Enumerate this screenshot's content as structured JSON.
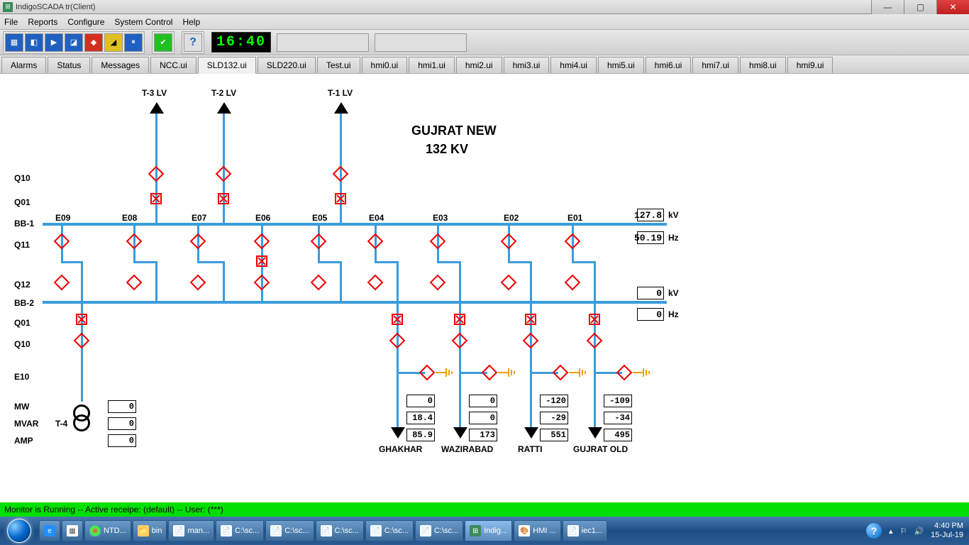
{
  "window": {
    "title": "IndigoSCADA tr(Client)"
  },
  "menu": {
    "items": [
      "File",
      "Reports",
      "Configure",
      "System Control",
      "Help"
    ]
  },
  "toolbar": {
    "clock": "16:40"
  },
  "tabs": {
    "items": [
      "Alarms",
      "Status",
      "Messages",
      "NCC.ui",
      "SLD132.ui",
      "SLD220.ui",
      "Test.ui",
      "hmi0.ui",
      "hmi1.ui",
      "hmi2.ui",
      "hmi3.ui",
      "hmi4.ui",
      "hmi5.ui",
      "hmi6.ui",
      "hmi7.ui",
      "hmi8.ui",
      "hmi9.ui"
    ],
    "active": 4
  },
  "diagram": {
    "title1": "GUJRAT NEW",
    "title2": "132 KV",
    "lv": {
      "t1": "T-1 LV",
      "t2": "T-2 LV",
      "t3": "T-3 LV"
    },
    "rows": {
      "q10": "Q10",
      "q01": "Q01",
      "bb1": "BB-1",
      "q11": "Q11",
      "q12": "Q12",
      "bb2": "BB-2",
      "q01b": "Q01",
      "q10b": "Q10",
      "e10": "E10",
      "mw": "MW",
      "mvar": "MVAR",
      "amp": "AMP",
      "t4": "T-4"
    },
    "bays": {
      "e01": "E01",
      "e02": "E02",
      "e03": "E03",
      "e04": "E04",
      "e05": "E05",
      "e06": "E06",
      "e07": "E07",
      "e08": "E08",
      "e09": "E09"
    },
    "meters": {
      "bb1_kv": "127.8",
      "bb1_kv_u": "kV",
      "bb1_hz": "50.19",
      "bb1_hz_u": "Hz",
      "bb2_kv": "0",
      "bb2_kv_u": "kV",
      "bb2_hz": "0",
      "bb2_hz_u": "Hz"
    },
    "t4": {
      "mw": "0",
      "mvar": "0",
      "amp": "0"
    },
    "feeders": {
      "ghakhar": {
        "name": "GHAKHAR",
        "mw": "0",
        "mvar": "18.4",
        "amp": "85.9"
      },
      "wazirabad": {
        "name": "WAZIRABAD",
        "mw": "0",
        "mvar": "0",
        "amp": "173"
      },
      "ratti": {
        "name": "RATTI",
        "mw": "-120",
        "mvar": "-29",
        "amp": "551"
      },
      "gujrat_old": {
        "name": "GUJRAT OLD",
        "mw": "-109",
        "mvar": "-34",
        "amp": "495"
      }
    }
  },
  "status": {
    "text": "Monitor is Running -- Active receipe: (default) -- User: (***)"
  },
  "taskbar": {
    "items": [
      {
        "label": "",
        "icon": "ie"
      },
      {
        "label": "",
        "icon": "calc"
      },
      {
        "label": "NTD...",
        "icon": "chrome"
      },
      {
        "label": "bin",
        "icon": "folder"
      },
      {
        "label": "man...",
        "icon": "doc"
      },
      {
        "label": "C:\\sc...",
        "icon": "doc"
      },
      {
        "label": "C:\\sc...",
        "icon": "doc"
      },
      {
        "label": "C:\\sc...",
        "icon": "doc"
      },
      {
        "label": "C:\\sc...",
        "icon": "doc"
      },
      {
        "label": "C:\\sc...",
        "icon": "doc"
      },
      {
        "label": "Indig...",
        "icon": "scada",
        "active": true
      },
      {
        "label": "HMI ...",
        "icon": "paint"
      },
      {
        "label": "iec1...",
        "icon": "doc"
      }
    ],
    "time": "4:40 PM",
    "date": "15-Jul-19"
  }
}
